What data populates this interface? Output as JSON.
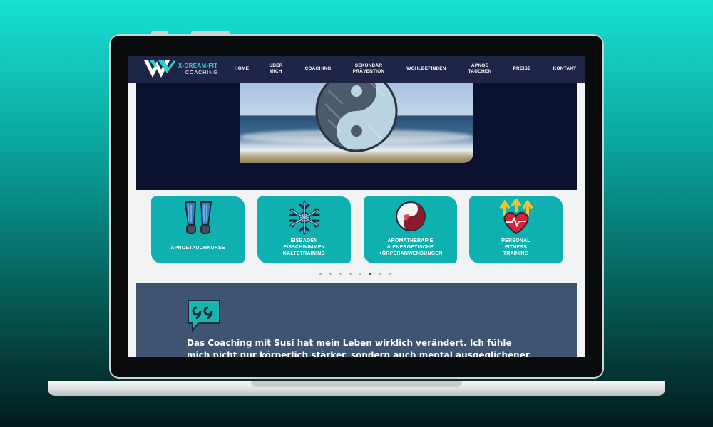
{
  "logo": {
    "brand": "X-DREAM-FIT",
    "sub": "COACHING"
  },
  "nav": {
    "items": [
      {
        "label": "HOME"
      },
      {
        "label": "ÜBER\nMICH"
      },
      {
        "label": "COACHING"
      },
      {
        "label": "SEKUNDÄR\nPRÄVENTION"
      },
      {
        "label": "WOHLBEFINDEN"
      },
      {
        "label": "APNOE\nTAUCHEN"
      },
      {
        "label": "PREISE"
      },
      {
        "label": "KONTAKT"
      }
    ]
  },
  "hero": {
    "image_icon": "yin-yang-icon"
  },
  "carousel": {
    "prev_arrow": "‹",
    "next_arrow": "›",
    "cards": [
      {
        "label": "APNOETAUCHKURSE",
        "icon": "fins-icon"
      },
      {
        "label": "EISBADEN\nEISSCHWIMMEN\nKÄLTETRAINING",
        "icon": "snowflake-icon"
      },
      {
        "label": "AROMATHERAPIE\n& ENERGETISCHE\nKÖRPERANWENDUNGEN",
        "icon": "yin-yang-heart-icon"
      },
      {
        "label": "PERSONAL\nFITNESS\nTRAINING",
        "icon": "heart-arrows-icon"
      }
    ],
    "dot_count": 8,
    "active_dot": 5
  },
  "testimonial": {
    "icon": "quote-bubble-icon",
    "text": "Das Coaching mit Susi hat mein Leben wirklich verändert. Ich fühle mich nicht nur körperlich stärker, sondern auch mental ausgeglichener. Danke für die"
  },
  "colors": {
    "nav": "#1f2547",
    "accent": "#0fb0b0",
    "hero_bg": "#0b1230",
    "testimonial_bg": "#3f5470"
  }
}
